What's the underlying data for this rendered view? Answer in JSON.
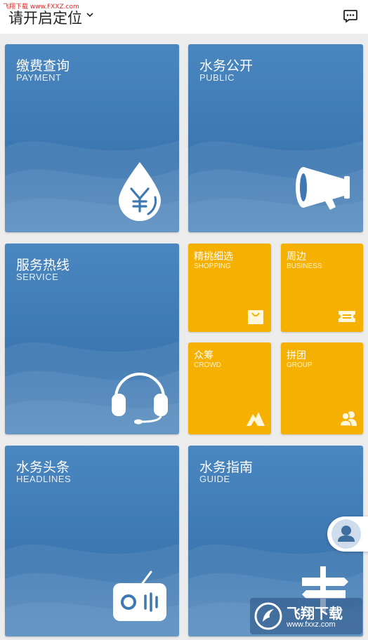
{
  "header": {
    "watermark": "飞翔下载 www.FXXZ.com",
    "location_label": "请开启定位",
    "message_icon": "chat-bubble-icon"
  },
  "tiles": {
    "payment": {
      "title": "缴费查询",
      "subtitle": "PAYMENT",
      "icon": "yen-drop-icon"
    },
    "public": {
      "title": "水务公开",
      "subtitle": "PUBLIC",
      "icon": "megaphone-icon"
    },
    "service": {
      "title": "服务热线",
      "subtitle": "SERVICE",
      "icon": "headset-icon"
    },
    "shopping": {
      "title": "精挑细选",
      "subtitle": "SHOPPING",
      "icon": "shopping-bag-icon"
    },
    "business": {
      "title": "周边",
      "subtitle": "BUSINESS",
      "icon": "ticket-icon"
    },
    "crowd": {
      "title": "众筹",
      "subtitle": "CROWD",
      "icon": "mountain-icon"
    },
    "group": {
      "title": "拼团",
      "subtitle": "GROUP",
      "icon": "people-icon"
    },
    "headlines": {
      "title": "水务头条",
      "subtitle": "HEADLINES",
      "icon": "radio-icon"
    },
    "guide": {
      "title": "水务指南",
      "subtitle": "GUIDE",
      "icon": "signpost-icon"
    }
  },
  "float": {
    "icon": "user-avatar-icon"
  },
  "watermark_logo": {
    "text": "飞翔下载",
    "url": "www.fxxz.com"
  },
  "colors": {
    "blue_tile": "#3b76b0",
    "yellow_tile": "#f5b000",
    "background": "#ececec"
  }
}
